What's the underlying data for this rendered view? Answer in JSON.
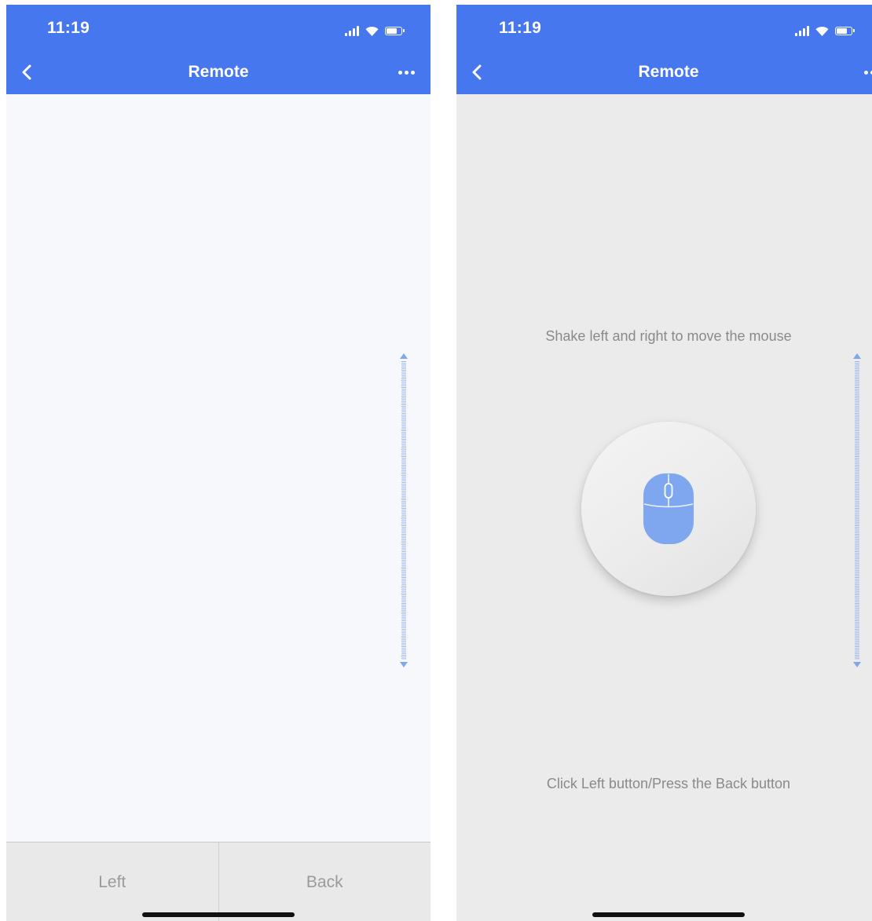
{
  "screens": [
    {
      "status_time": "11:19",
      "title": "Remote",
      "bottom_buttons": {
        "left_label": "Left",
        "back_label": "Back"
      }
    },
    {
      "status_time": "11:19",
      "title": "Remote",
      "hint_top": "Shake left and right to move the mouse",
      "hint_bottom": "Click Left button/Press the Back button"
    }
  ],
  "icons": {
    "back": "chevron-left-icon",
    "more": "more-horizontal-icon",
    "mouse": "mouse-icon",
    "scroll": "scroll-track-arrows-icon"
  },
  "colors": {
    "header": "#4677ee",
    "accent_light": "#7fa7ef",
    "scroll_track": "#9db8f0",
    "left_screen_bg": "#f6f8fb",
    "right_screen_bg": "#ebebeb",
    "bottom_bar": "#e9e9e9"
  }
}
